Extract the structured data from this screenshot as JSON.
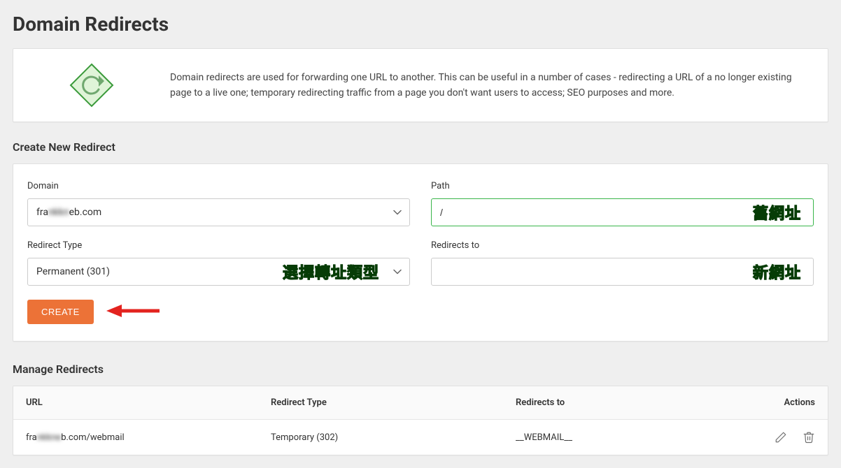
{
  "page_title": "Domain Redirects",
  "intro": {
    "description": "Domain redirects are used for forwarding one URL to another. This can be useful in a number of cases - redirecting a URL of a no longer existing page to a live one; temporary redirecting traffic from a page you don't want users to access; SEO purposes and more."
  },
  "create": {
    "section_title": "Create New Redirect",
    "domain": {
      "label": "Domain",
      "value_prefix": "fra",
      "value_blur": "nkkn",
      "value_suffix": "eb.com"
    },
    "path": {
      "label": "Path",
      "value": "/",
      "annotation": "舊網址"
    },
    "redirect_type": {
      "label": "Redirect Type",
      "value": "Permanent (301)",
      "annotation": "選擇轉址類型"
    },
    "redirects_to": {
      "label": "Redirects to",
      "value": "",
      "annotation": "新網址"
    },
    "button_label": "CREATE"
  },
  "manage": {
    "section_title": "Manage Redirects",
    "columns": {
      "url": "URL",
      "type": "Redirect Type",
      "to": "Redirects to",
      "actions": "Actions"
    },
    "rows": [
      {
        "url_prefix": "fra",
        "url_blur": "nkkne",
        "url_suffix": "b.com/webmail",
        "type": "Temporary (302)",
        "to": "__WEBMAIL__"
      }
    ]
  },
  "icons": {
    "redirect_diamond": "redirect-icon",
    "chevron_down": "chevron-down-icon",
    "edit": "pencil-icon",
    "delete": "trash-icon"
  }
}
